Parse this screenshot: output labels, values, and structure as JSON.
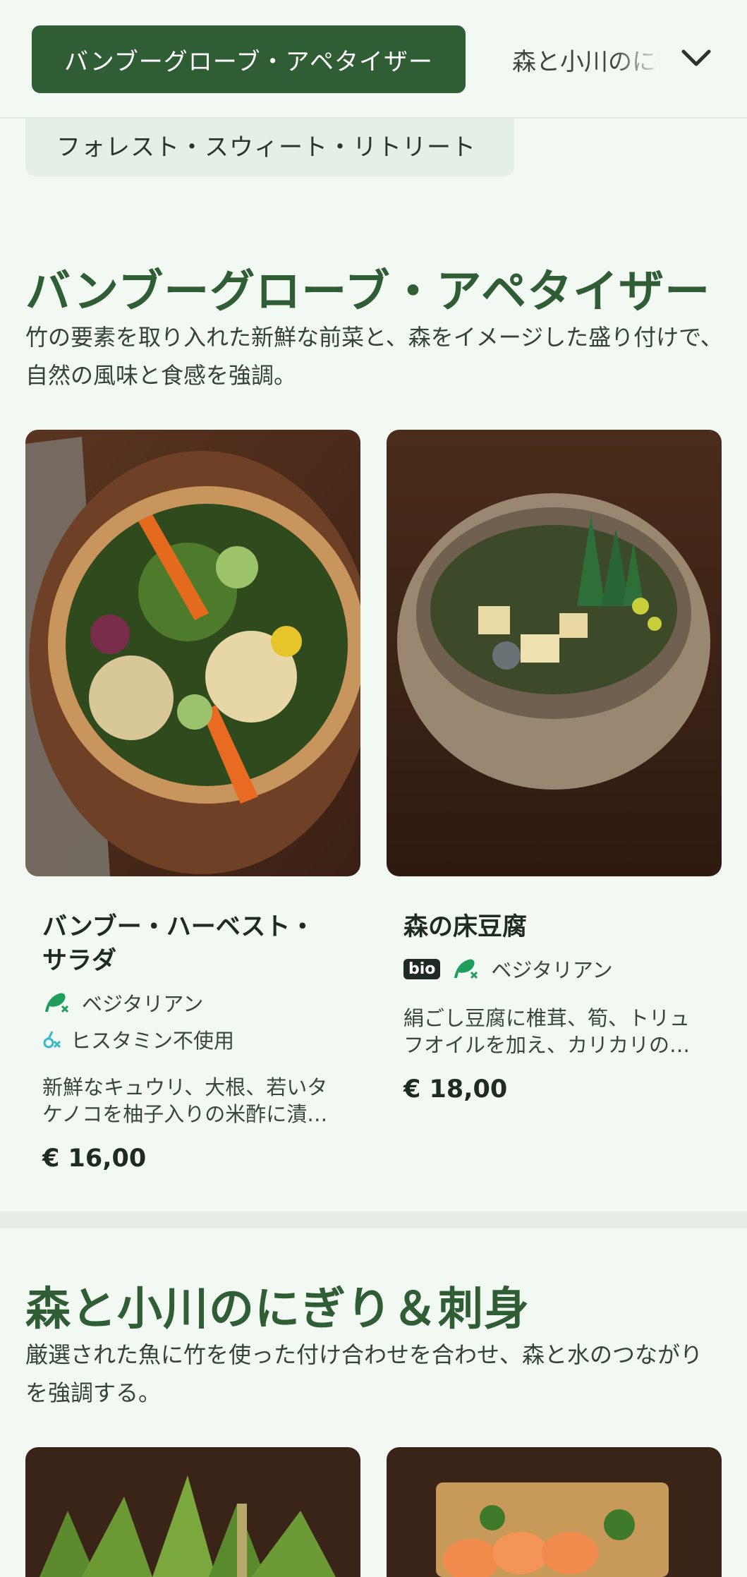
{
  "nav": {
    "active_tab": "バンブーグローブ・アペタイザー",
    "next_tab": "森と小川のにぎり＆刺身",
    "pill": "フォレスト・スウィート・リトリート"
  },
  "sections": [
    {
      "title": "バンブーグローブ・アペタイザー",
      "description": "竹の要素を取り入れた新鮮な前菜と、森をイメージした盛り付けで、自然の風味と食感を強調。",
      "items": [
        {
          "title": "バンブー・ハーベスト・サラダ",
          "tag_vegetarian": "ベジタリアン",
          "tag_histamine": "ヒスタミン不使用",
          "description": "新鮮なキュウリ、大根、若いタケノコを柚子入りの米酢に漬…",
          "price": "€ 16,00"
        },
        {
          "title": "森の床豆腐",
          "badge_bio": "bio",
          "tag_vegetarian": "ベジタリアン",
          "description": "絹ごし豆腐に椎茸、筍、トリュフオイルを加え、カリカリの…",
          "price": "€ 18,00"
        }
      ]
    },
    {
      "title": "森と小川のにぎり＆刺身",
      "description": "厳選された魚に竹を使った付け合わせを合わせ、森と水のつながりを強調する。"
    }
  ],
  "colors": {
    "accent": "#2f5d34",
    "background": "#f2f8f2",
    "tag_green": "#1e9e5a"
  }
}
